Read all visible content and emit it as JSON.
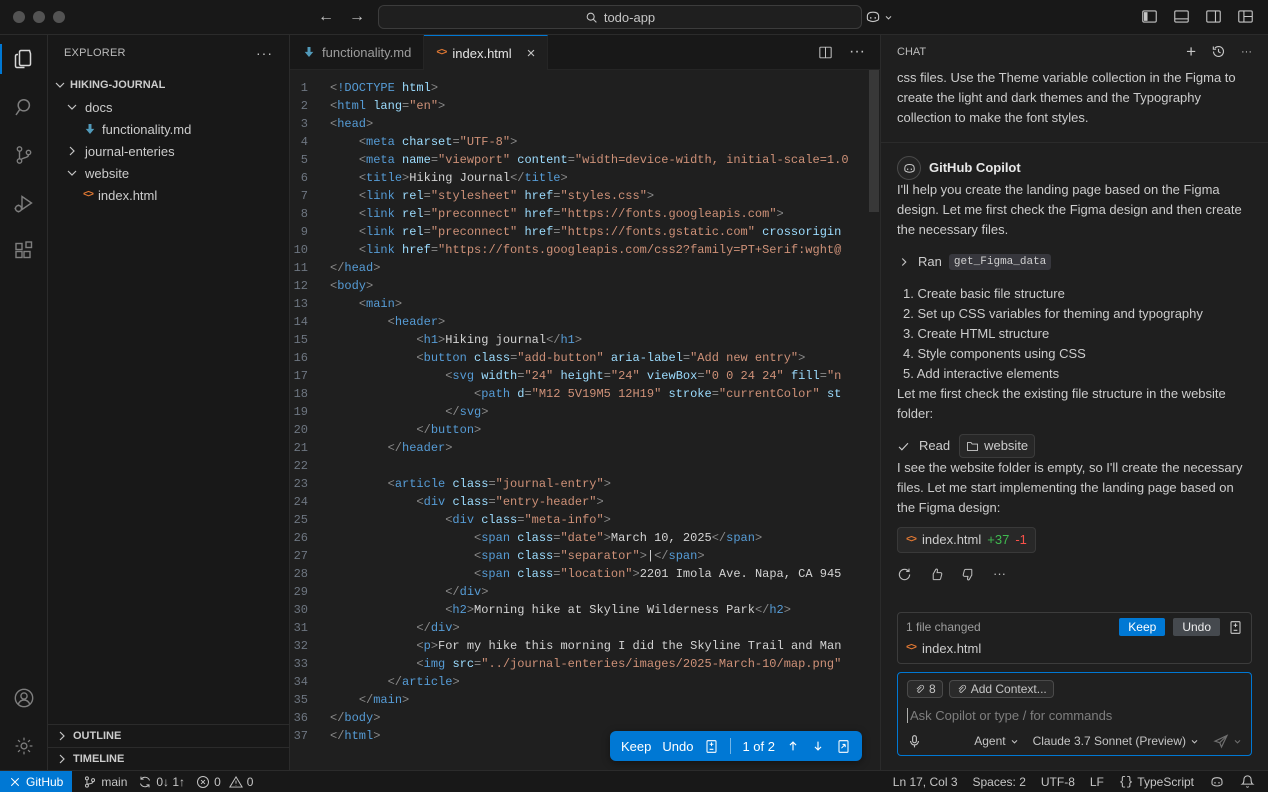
{
  "colors": {
    "accent": "#0078d4",
    "bg_dark": "#181818",
    "bg_editor": "#1f1f1f",
    "border": "#2b2b2b",
    "code_tag": "#569cd6",
    "code_attr": "#9cdcfe",
    "code_string": "#ce9178",
    "added_green": "#3fb950",
    "removed_red": "#f85149",
    "md_icon_blue": "#519aba",
    "html_icon_orange": "#e37933"
  },
  "titlebar": {
    "search_value": "todo-app"
  },
  "explorer": {
    "title": "EXPLORER",
    "root": "HIKING-JOURNAL",
    "tree": [
      {
        "label": "docs",
        "icon": "chevron-down",
        "indent": 0
      },
      {
        "label": "functionality.md",
        "icon": "md",
        "indent": 1
      },
      {
        "label": "journal-enteries",
        "icon": "chevron-right",
        "indent": 0
      },
      {
        "label": "website",
        "icon": "chevron-down",
        "indent": 0
      },
      {
        "label": "index.html",
        "icon": "html",
        "indent": 1
      }
    ],
    "sections": [
      "OUTLINE",
      "TIMELINE"
    ]
  },
  "tabs": [
    {
      "label": "functionality.md",
      "icon": "md",
      "active": false
    },
    {
      "label": "index.html",
      "icon": "html",
      "active": true
    }
  ],
  "editor": {
    "lines": [
      "<!DOCTYPE html>",
      "<html lang=\"en\">",
      "<head>",
      "    <meta charset=\"UTF-8\">",
      "    <meta name=\"viewport\" content=\"width=device-width, initial-scale=1.0",
      "    <title>Hiking Journal</title>",
      "    <link rel=\"stylesheet\" href=\"styles.css\">",
      "    <link rel=\"preconnect\" href=\"https://fonts.googleapis.com\">",
      "    <link rel=\"preconnect\" href=\"https://fonts.gstatic.com\" crossorigin",
      "    <link href=\"https://fonts.googleapis.com/css2?family=PT+Serif:wght@",
      "</head>",
      "<body>",
      "    <main>",
      "        <header>",
      "            <h1>Hiking journal</h1>",
      "            <button class=\"add-button\" aria-label=\"Add new entry\">",
      "                <svg width=\"24\" height=\"24\" viewBox=\"0 0 24 24\" fill=\"n",
      "                    <path d=\"M12 5V19M5 12H19\" stroke=\"currentColor\" st",
      "                </svg>",
      "            </button>",
      "        </header>",
      "",
      "        <article class=\"journal-entry\">",
      "            <div class=\"entry-header\">",
      "                <div class=\"meta-info\">",
      "                    <span class=\"date\">March 10, 2025</span>",
      "                    <span class=\"separator\">|</span>",
      "                    <span class=\"location\">2201 Imola Ave. Napa, CA 945",
      "                </div>",
      "                <h2>Morning hike at Skyline Wilderness Park</h2>",
      "            </div>",
      "            <p>For my hike this morning I did the Skyline Trail and Man",
      "            <img src=\"../journal-enteries/images/2025-March-10/map.png\"",
      "        </article>",
      "    </main>",
      "</body>",
      "</html>"
    ],
    "review": {
      "keep": "Keep",
      "undo": "Undo",
      "counter": "1 of 2"
    }
  },
  "chat": {
    "title": "CHAT",
    "scrolled_user_text": "css files. Use the Theme variable collection in the Figma to create the light and dark themes and the Typography collection to make the font styles.",
    "assistant_name": "GitHub Copilot",
    "intro": "I'll help you create the landing page based on the Figma design. Let me first check the Figma design and then create the necessary files.",
    "tool_run": {
      "prefix": "Ran",
      "name": "get_Figma_data"
    },
    "steps": [
      "Create basic file structure",
      "Set up CSS variables for theming and typography",
      "Create HTML structure",
      "Style components using CSS",
      "Add interactive elements"
    ],
    "check_text": "Let me first check the existing file structure in the website folder:",
    "read_row": {
      "label": "Read",
      "target": "website"
    },
    "followup": "I see the website folder is empty, so I'll create the necessary files. Let me start implementing the landing page based on the Figma design:",
    "file_chip": {
      "name": "index.html",
      "added": "+37",
      "removed": "-1"
    },
    "changes_box": {
      "summary": "1 file changed",
      "keep": "Keep",
      "undo": "Undo",
      "file": "index.html"
    },
    "input": {
      "attachment_count": "8",
      "add_context": "Add Context...",
      "placeholder": "Ask Copilot or type / for commands",
      "mode": "Agent",
      "model": "Claude 3.7 Sonnet (Preview)"
    }
  },
  "status_bar": {
    "remote": "GitHub",
    "branch": "main",
    "sync": "0↓ 1↑",
    "errors": "0",
    "warnings": "0",
    "line_col": "Ln 17, Col 3",
    "indent": "Spaces: 2",
    "encoding": "UTF-8",
    "eol": "LF",
    "language": "TypeScript"
  }
}
